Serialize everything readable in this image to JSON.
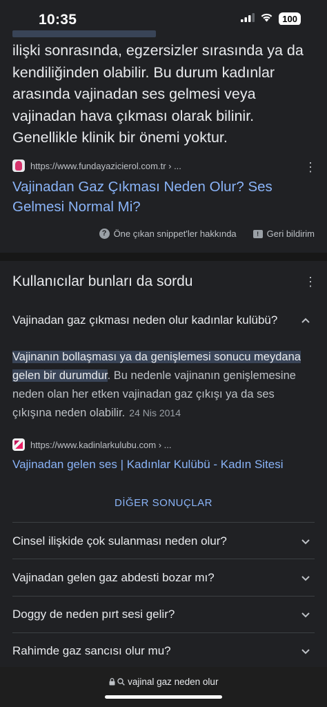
{
  "status_bar": {
    "time": "10:35",
    "battery": "100"
  },
  "snippet": {
    "text": "ilişki sonrasında, egzersizler sırasında ya da kendiliğinden olabilir. Bu durum kadınlar arasında vajinadan ses gelmesi veya vajinadan hava çıkması olarak bilinir. Genellikle klinik bir önemi yoktur.",
    "source_url": "https://www.fundayazicierol.com.tr › ...",
    "link_text": "Vajinadan Gaz Çıkması Neden Olur? Ses Gelmesi Normal Mi?",
    "about_label": "Öne çıkan snippet'ler hakkında",
    "feedback_label": "Geri bildirim"
  },
  "people_also_ask": {
    "title": "Kullanıcılar bunları da sordu",
    "expanded": {
      "question": "Vajinadan gaz çıkması neden olur kadınlar kulübü?",
      "answer_highlight": "Vajinanın bollaşması ya da genişlemesi sonucu meydana gelen bir durumdur",
      "answer_rest": ". Bu nedenle vajinanın genişlemesine neden olan her etken vajinadan gaz çıkışı ya da ses çıkışına neden olabilir.",
      "answer_date": "24 Nis 2014",
      "source_url": "https://www.kadinlarkulubu.com › ...",
      "link_text": "Vajinadan gelen ses | Kadınlar Kulübü - Kadın Sitesi"
    },
    "more_results": "DİĞER SONUÇLAR",
    "questions": [
      "Cinsel ilişkide çok sulanması neden olur?",
      "Vajinadan gelen gaz abdesti bozar mı?",
      "Doggy de neden pırt sesi gelir?",
      "Rahimde gaz sancısı olur mu?"
    ]
  },
  "url_bar": {
    "text": "vajinal gaz neden olur"
  }
}
